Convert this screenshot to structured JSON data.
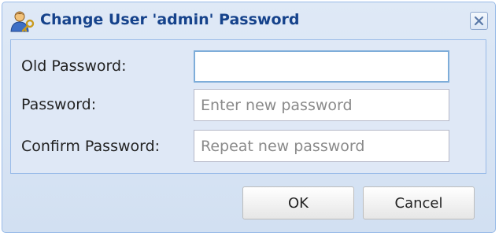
{
  "dialog": {
    "title": "Change User 'admin' Password",
    "title_icon": "user-key-icon",
    "close_icon": "close-icon"
  },
  "form": {
    "old_password": {
      "label": "Old Password:",
      "value": "",
      "placeholder": ""
    },
    "password": {
      "label": "Password:",
      "value": "",
      "placeholder": "Enter new password"
    },
    "confirm_password": {
      "label": "Confirm Password:",
      "value": "",
      "placeholder": "Repeat new password"
    }
  },
  "buttons": {
    "ok_label": "OK",
    "cancel_label": "Cancel"
  },
  "colors": {
    "title_text": "#15428b",
    "dialog_border": "#99bbe8",
    "dialog_bg": "#dfe9f6",
    "focus_border": "#7eadd9"
  }
}
